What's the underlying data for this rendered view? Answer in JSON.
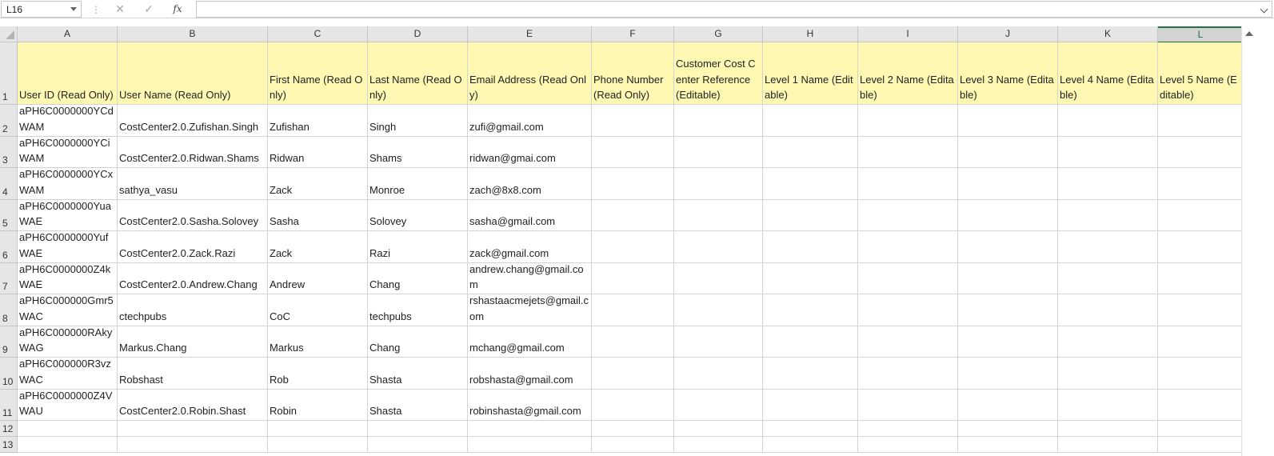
{
  "formula_bar": {
    "name_box": "L16",
    "separator": "⋮",
    "cancel_icon": "✕",
    "enter_icon": "✓",
    "fx_label": "fx",
    "formula": ""
  },
  "columns": [
    "A",
    "B",
    "C",
    "D",
    "E",
    "F",
    "G",
    "H",
    "I",
    "J",
    "K",
    "L"
  ],
  "active_column": "L",
  "row_numbers": [
    "1",
    "2",
    "3",
    "4",
    "5",
    "6",
    "7",
    "8",
    "9",
    "10",
    "11",
    "12",
    "13"
  ],
  "header_row": [
    "User ID (Read Only)",
    "User Name (Read Only)",
    "First Name (Read Only)",
    "Last Name (Read Only)",
    "Email Address (Read Only)",
    "Phone Number (Read Only)",
    "Customer Cost Center Reference (Editable)",
    "Level 1 Name (Editable)",
    "Level 2 Name (Editable)",
    "Level 3 Name (Editable)",
    "Level 4 Name (Editable)",
    "Level 5 Name (Editable)"
  ],
  "rows": [
    [
      "aPH6C0000000YCdWAM",
      "CostCenter2.0.Zufishan.Singh",
      "Zufishan",
      "Singh",
      "zufi@gmail.com",
      "",
      "",
      "",
      "",
      "",
      "",
      ""
    ],
    [
      "aPH6C0000000YCiWAM",
      "CostCenter2.0.Ridwan.Shams",
      "Ridwan",
      "Shams",
      "ridwan@gmai.com",
      "",
      "",
      "",
      "",
      "",
      "",
      ""
    ],
    [
      "aPH6C0000000YCxWAM",
      "sathya_vasu",
      "Zack",
      "Monroe",
      "zach@8x8.com",
      "",
      "",
      "",
      "",
      "",
      "",
      ""
    ],
    [
      "aPH6C0000000YuaWAE",
      "CostCenter2.0.Sasha.Solovey",
      "Sasha",
      "Solovey",
      "sasha@gmail.com",
      "",
      "",
      "",
      "",
      "",
      "",
      ""
    ],
    [
      "aPH6C0000000YufWAE",
      "CostCenter2.0.Zack.Razi",
      "Zack",
      "Razi",
      "zack@gmail.com",
      "",
      "",
      "",
      "",
      "",
      "",
      ""
    ],
    [
      "aPH6C0000000Z4kWAE",
      "CostCenter2.0.Andrew.Chang",
      "Andrew",
      "Chang",
      "andrew.chang@gmail.com",
      "",
      "",
      "",
      "",
      "",
      "",
      ""
    ],
    [
      "aPH6C000000Gmr5WAC",
      "ctechpubs",
      "CoC",
      "techpubs",
      "rshastaacmejets@gmail.com",
      "",
      "",
      "",
      "",
      "",
      "",
      ""
    ],
    [
      "aPH6C000000RAkyWAG",
      "Markus.Chang",
      "Markus",
      "Chang",
      "mchang@gmail.com",
      "",
      "",
      "",
      "",
      "",
      "",
      ""
    ],
    [
      "aPH6C000000R3vzWAC",
      "Robshast",
      "Rob",
      "Shasta",
      "robshasta@gmail.com",
      "",
      "",
      "",
      "",
      "",
      "",
      ""
    ],
    [
      "aPH6C0000000Z4VWAU",
      "CostCenter2.0.Robin.Shast",
      "Robin",
      "Shasta",
      "robinshasta@gmail.com",
      "",
      "",
      "",
      "",
      "",
      "",
      ""
    ],
    [
      "",
      "",
      "",
      "",
      "",
      "",
      "",
      "",
      "",
      "",
      "",
      ""
    ],
    [
      "",
      "",
      "",
      "",
      "",
      "",
      "",
      "",
      "",
      "",
      "",
      ""
    ]
  ]
}
